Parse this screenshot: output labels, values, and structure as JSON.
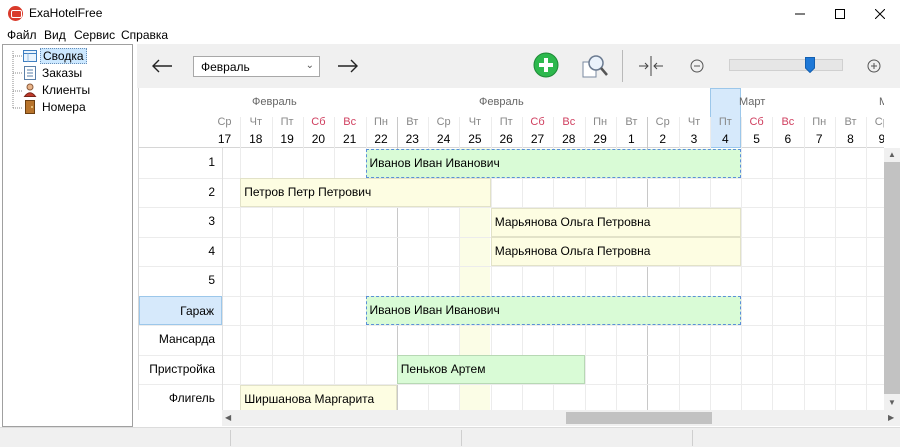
{
  "window": {
    "title": "ExaHotelFree"
  },
  "menu": [
    "Файл",
    "Вид",
    "Сервис",
    "Справка"
  ],
  "tree": [
    {
      "label": "Сводка",
      "icon": "summary-icon",
      "selected": true
    },
    {
      "label": "Заказы",
      "icon": "orders-icon",
      "selected": false
    },
    {
      "label": "Клиенты",
      "icon": "clients-icon",
      "selected": false
    },
    {
      "label": "Номера",
      "icon": "rooms-icon",
      "selected": false
    }
  ],
  "toolbar": {
    "month": "Февраль",
    "zoom_level": 0.73
  },
  "calendar": {
    "months": [
      "Февраль",
      "Февраль",
      "Март",
      "М"
    ],
    "days": [
      {
        "dow": "Ср",
        "num": "17"
      },
      {
        "dow": "Чт",
        "num": "18"
      },
      {
        "dow": "Пт",
        "num": "19"
      },
      {
        "dow": "Сб",
        "num": "20"
      },
      {
        "dow": "Вс",
        "num": "21"
      },
      {
        "dow": "Пн",
        "num": "22"
      },
      {
        "dow": "Вт",
        "num": "23"
      },
      {
        "dow": "Ср",
        "num": "24"
      },
      {
        "dow": "Чт",
        "num": "25"
      },
      {
        "dow": "Пт",
        "num": "26"
      },
      {
        "dow": "Сб",
        "num": "27"
      },
      {
        "dow": "Вс",
        "num": "28"
      },
      {
        "dow": "Пн",
        "num": "29"
      },
      {
        "dow": "Вт",
        "num": "1"
      },
      {
        "dow": "Ср",
        "num": "2"
      },
      {
        "dow": "Чт",
        "num": "3"
      },
      {
        "dow": "Пт",
        "num": "4"
      },
      {
        "dow": "Сб",
        "num": "5"
      },
      {
        "dow": "Вс",
        "num": "6"
      },
      {
        "dow": "Пн",
        "num": "7"
      },
      {
        "dow": "Вт",
        "num": "8"
      },
      {
        "dow": "Ср",
        "num": "9"
      }
    ],
    "rooms": [
      "1",
      "2",
      "3",
      "4",
      "5",
      "Гараж",
      "Мансарда",
      "Пристройка",
      "Флигель"
    ],
    "bookings": [
      {
        "room": "1",
        "guest": "Иванов Иван Иванович",
        "style": "green",
        "selected": true
      },
      {
        "room": "2",
        "guest": "Петров Петр Петрович",
        "style": "yellow",
        "selected": false
      },
      {
        "room": "3",
        "guest": "Марьянова Ольга Петровна",
        "style": "yellow",
        "selected": false
      },
      {
        "room": "4",
        "guest": "Марьянова Ольга Петровна",
        "style": "yellow",
        "selected": false
      },
      {
        "room": "Гараж",
        "guest": "Иванов Иван Иванович",
        "style": "green",
        "selected": true
      },
      {
        "room": "Пристройка",
        "guest": "Пеньков Артем",
        "style": "green",
        "selected": false
      },
      {
        "room": "Флигель",
        "guest": "Ширшанова Маргарита",
        "style": "yellow",
        "selected": false
      }
    ]
  },
  "colors": {
    "booking_green": "#d9fbd6",
    "booking_yellow": "#fdfde2",
    "selection_border": "#5b8fd8",
    "weekend_text": "#d04060",
    "add_button": "#2db84d"
  }
}
